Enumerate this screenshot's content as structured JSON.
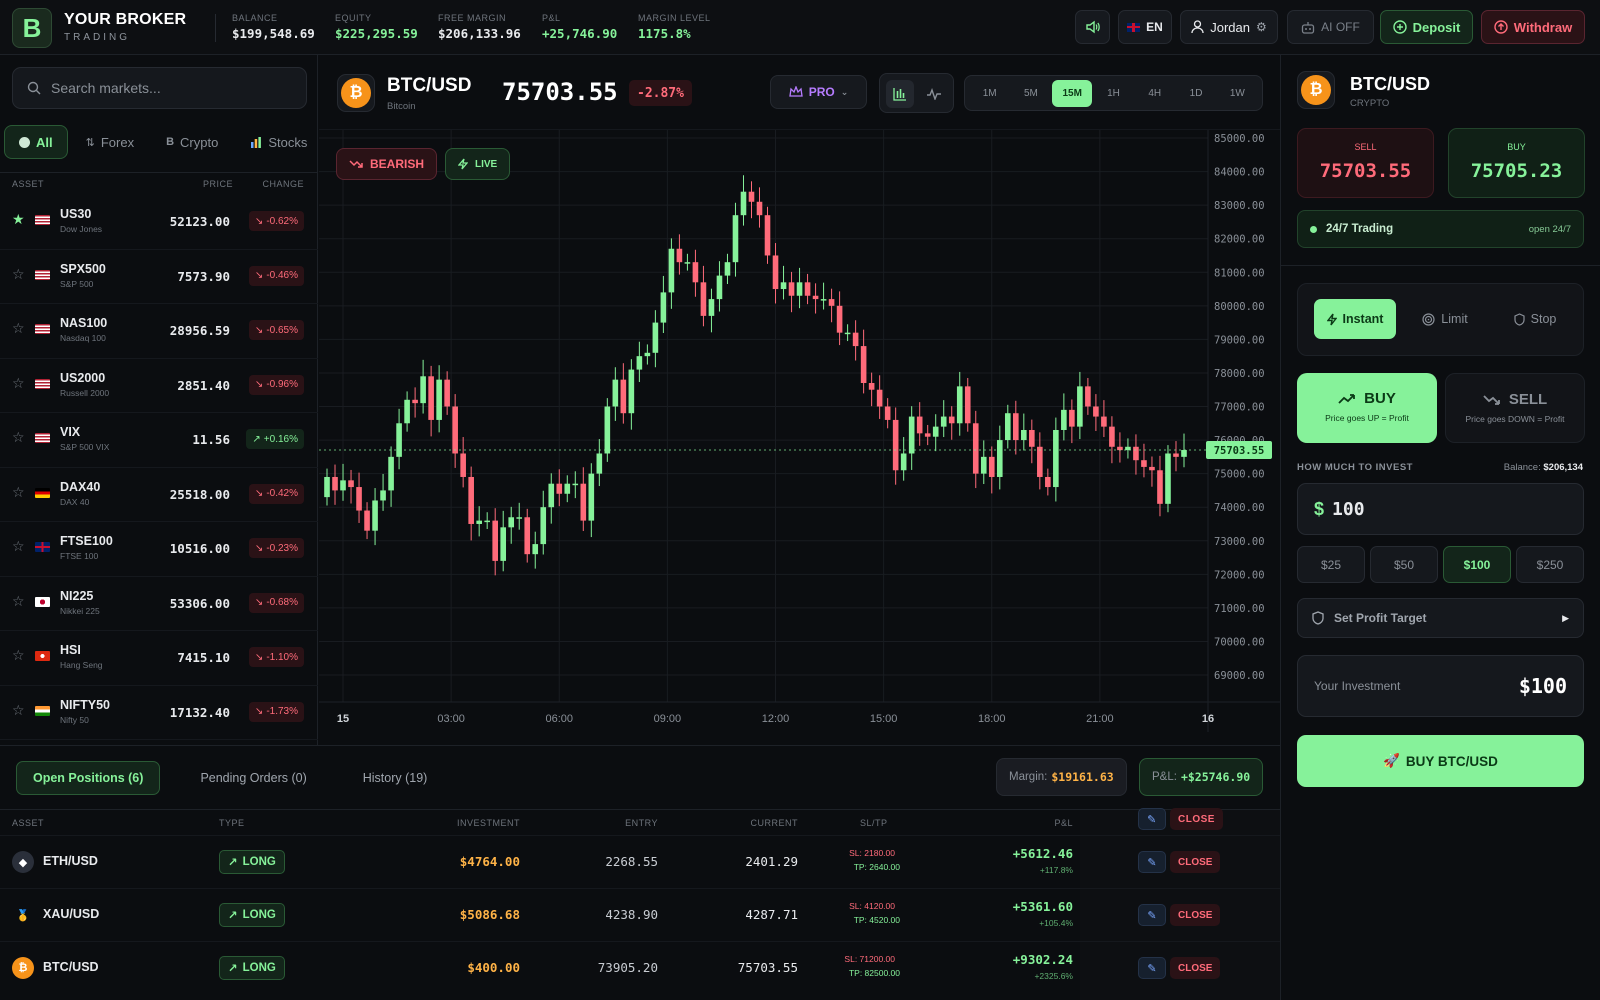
{
  "brand": {
    "logo_letter": "B",
    "name": "YOUR BROKER",
    "tagline": "TRADING"
  },
  "account": [
    {
      "label": "BALANCE",
      "value": "$199,548.69",
      "green": false
    },
    {
      "label": "EQUITY",
      "value": "$225,295.59",
      "green": true
    },
    {
      "label": "FREE MARGIN",
      "value": "$206,133.96",
      "green": false
    },
    {
      "label": "P&L",
      "value": "+25,746.90",
      "green": true
    },
    {
      "label": "MARGIN LEVEL",
      "value": "1175.8%",
      "green": true
    }
  ],
  "topbar": {
    "sound_icon": "speaker-icon",
    "language": "EN",
    "user": "Jordan",
    "ai_label": "AI OFF",
    "deposit": "Deposit",
    "withdraw": "Withdraw"
  },
  "market": {
    "search_placeholder": "Search markets...",
    "filters": [
      "All",
      "Forex",
      "Crypto",
      "Stocks"
    ],
    "active_filter": "All",
    "headers": {
      "asset": "ASSET",
      "price": "PRICE",
      "change": "CHANGE"
    },
    "assets": [
      {
        "symbol": "US30",
        "name": "Dow Jones",
        "price": "52123.00",
        "change": "-0.62%",
        "up": false,
        "fav": true,
        "flag": "us"
      },
      {
        "symbol": "SPX500",
        "name": "S&P 500",
        "price": "7573.90",
        "change": "-0.46%",
        "up": false,
        "fav": false,
        "flag": "us"
      },
      {
        "symbol": "NAS100",
        "name": "Nasdaq 100",
        "price": "28956.59",
        "change": "-0.65%",
        "up": false,
        "fav": false,
        "flag": "us"
      },
      {
        "symbol": "US2000",
        "name": "Russell 2000",
        "price": "2851.40",
        "change": "-0.96%",
        "up": false,
        "fav": false,
        "flag": "us"
      },
      {
        "symbol": "VIX",
        "name": "S&P 500 VIX",
        "price": "11.56",
        "change": "+0.16%",
        "up": true,
        "fav": false,
        "flag": "us"
      },
      {
        "symbol": "DAX40",
        "name": "DAX 40",
        "price": "25518.00",
        "change": "-0.42%",
        "up": false,
        "fav": false,
        "flag": "de"
      },
      {
        "symbol": "FTSE100",
        "name": "FTSE 100",
        "price": "10516.00",
        "change": "-0.23%",
        "up": false,
        "fav": false,
        "flag": "gb"
      },
      {
        "symbol": "NI225",
        "name": "Nikkei 225",
        "price": "53306.00",
        "change": "-0.68%",
        "up": false,
        "fav": false,
        "flag": "jp"
      },
      {
        "symbol": "HSI",
        "name": "Hang Seng",
        "price": "7415.10",
        "change": "-1.10%",
        "up": false,
        "fav": false,
        "flag": "hk"
      },
      {
        "symbol": "NIFTY50",
        "name": "Nifty 50",
        "price": "17132.40",
        "change": "-1.73%",
        "up": false,
        "fav": false,
        "flag": "in"
      }
    ]
  },
  "chart_header": {
    "coin_glyph": "₿",
    "pair": "BTC/USD",
    "name": "Bitcoin",
    "price": "75703.55",
    "change": "-2.87%",
    "pro": "PRO",
    "timeframes": [
      "1M",
      "5M",
      "15M",
      "1H",
      "4H",
      "1D",
      "1W"
    ],
    "active_tf": "15M",
    "sentiment": "BEARISH",
    "live": "LIVE"
  },
  "chart_data": {
    "type": "candlestick",
    "symbol": "BTC/USD",
    "interval": "15M",
    "ylim": [
      68500,
      85500
    ],
    "yticks": [
      "85000.00",
      "84000.00",
      "83000.00",
      "82000.00",
      "81000.00",
      "80000.00",
      "79000.00",
      "78000.00",
      "77000.00",
      "76000.00",
      "75000.00",
      "74000.00",
      "73000.00",
      "72000.00",
      "71000.00",
      "70000.00",
      "69000.00"
    ],
    "xticks": [
      {
        "label": "15",
        "bold": true
      },
      {
        "label": "03:00"
      },
      {
        "label": "06:00"
      },
      {
        "label": "09:00"
      },
      {
        "label": "12:00"
      },
      {
        "label": "15:00"
      },
      {
        "label": "18:00"
      },
      {
        "label": "21:00"
      },
      {
        "label": "16",
        "bold": true
      }
    ],
    "last_price": "75703.55",
    "close": [
      74900,
      74500,
      74800,
      74600,
      73900,
      73300,
      74200,
      74500,
      75500,
      76500,
      77200,
      77100,
      77900,
      76600,
      77800,
      77000,
      75600,
      74900,
      73500,
      73600,
      73600,
      72400,
      73400,
      73700,
      73700,
      72600,
      72900,
      74000,
      74700,
      74400,
      74700,
      74700,
      73600,
      75000,
      75600,
      77000,
      77800,
      76800,
      78100,
      78500,
      78600,
      79500,
      80400,
      81700,
      81300,
      81300,
      80700,
      79700,
      80200,
      80900,
      81300,
      82700,
      83400,
      83100,
      82700,
      81500,
      80500,
      80700,
      80300,
      80700,
      80300,
      80200,
      80200,
      80000,
      79200,
      79200,
      78800,
      77700,
      77500,
      77000,
      76600,
      75100,
      75600,
      76700,
      76200,
      76100,
      76400,
      76700,
      76500,
      77600,
      76500,
      75000,
      75500,
      74900,
      76000,
      76800,
      76000,
      76300,
      75800,
      74900,
      74600,
      76300,
      76900,
      76400,
      77600,
      77000,
      76700,
      76400,
      75800,
      75700,
      75800,
      75400,
      75200,
      75100,
      74100,
      75600,
      75500,
      75703.55
    ],
    "open": [
      74300,
      74900,
      74500,
      74800,
      74600,
      73900,
      73300,
      74200,
      74500,
      75500,
      76500,
      77200,
      77100,
      77900,
      76600,
      77800,
      77000,
      75600,
      74900,
      73500,
      73600,
      73600,
      72400,
      73400,
      73700,
      73700,
      72600,
      72900,
      74000,
      74700,
      74400,
      74700,
      74700,
      73600,
      75000,
      75600,
      77000,
      77800,
      76800,
      78100,
      78500,
      78600,
      79500,
      80400,
      81700,
      81300,
      81300,
      80700,
      79700,
      80200,
      80900,
      81300,
      82700,
      83400,
      83100,
      82700,
      81500,
      80500,
      80700,
      80300,
      80700,
      80300,
      80200,
      80200,
      80000,
      79200,
      79200,
      78800,
      77700,
      77500,
      77000,
      76600,
      75100,
      75600,
      76700,
      76200,
      76100,
      76400,
      76700,
      76500,
      77600,
      76500,
      75000,
      75500,
      74900,
      76000,
      76800,
      76000,
      76300,
      75800,
      74900,
      74600,
      76300,
      76900,
      76400,
      77600,
      77000,
      76700,
      76400,
      75800,
      75700,
      75800,
      75400,
      75200,
      75100,
      74100,
      75600,
      75500
    ]
  },
  "positions": {
    "tabs": [
      "Open Positions (6)",
      "Pending Orders (0)",
      "History (19)"
    ],
    "margin_label": "Margin:",
    "margin_value": "$19161.63",
    "pnl_label": "P&L:",
    "pnl_value": "+$25746.90",
    "headers": [
      "ASSET",
      "TYPE",
      "INVESTMENT",
      "ENTRY",
      "CURRENT",
      "SL/TP",
      "P&L"
    ],
    "close_label": "CLOSE",
    "rows": [
      {
        "asset": "ETH/USD",
        "icon": "eth",
        "type": "LONG",
        "investment": "$4764.00",
        "entry": "2268.55",
        "current": "2401.29",
        "sl": "SL: 2180.00",
        "tp": "TP: 2640.00",
        "pnl": "+5612.46",
        "pnl_pct": "+117.8%"
      },
      {
        "asset": "XAU/USD",
        "icon": "gold",
        "type": "LONG",
        "investment": "$5086.68",
        "entry": "4238.90",
        "current": "4287.71",
        "sl": "SL: 4120.00",
        "tp": "TP: 4520.00",
        "pnl": "+5361.60",
        "pnl_pct": "+105.4%"
      },
      {
        "asset": "BTC/USD",
        "icon": "btc",
        "type": "LONG",
        "investment": "$400.00",
        "entry": "73905.20",
        "current": "75703.55",
        "sl": "SL: 71200.00",
        "tp": "TP: 82500.00",
        "pnl": "+9302.24",
        "pnl_pct": "+2325.6%"
      }
    ]
  },
  "ticket": {
    "pair": "BTC/USD",
    "category": "CRYPTO",
    "sell_label": "SELL",
    "sell_price": "75703.55",
    "buy_label": "BUY",
    "buy_price": "75705.23",
    "trading_hours": "24/7 Trading",
    "trading_note": "open 24/7",
    "order_types": [
      "Instant",
      "Limit",
      "Stop"
    ],
    "active_order_type": "Instant",
    "buy_title": "BUY",
    "buy_desc": "Price goes UP = Profit",
    "sell_title": "SELL",
    "sell_desc": "Price goes DOWN = Profit",
    "invest_label": "HOW MUCH TO INVEST",
    "balance_label": "Balance:",
    "balance_value": "$206,134",
    "currency": "$",
    "amount": "100",
    "presets": [
      "$25",
      "$50",
      "$100",
      "$250"
    ],
    "active_preset": "$100",
    "profit_target": "Set Profit Target",
    "your_investment_label": "Your Investment",
    "your_investment_value": "$100",
    "submit": "BUY BTC/USD"
  },
  "colors": {
    "accent": "#86f29a",
    "down": "#ff6b7a",
    "warn": "#ffb347",
    "pro": "#b67cff",
    "bg": "#0b0d10"
  }
}
